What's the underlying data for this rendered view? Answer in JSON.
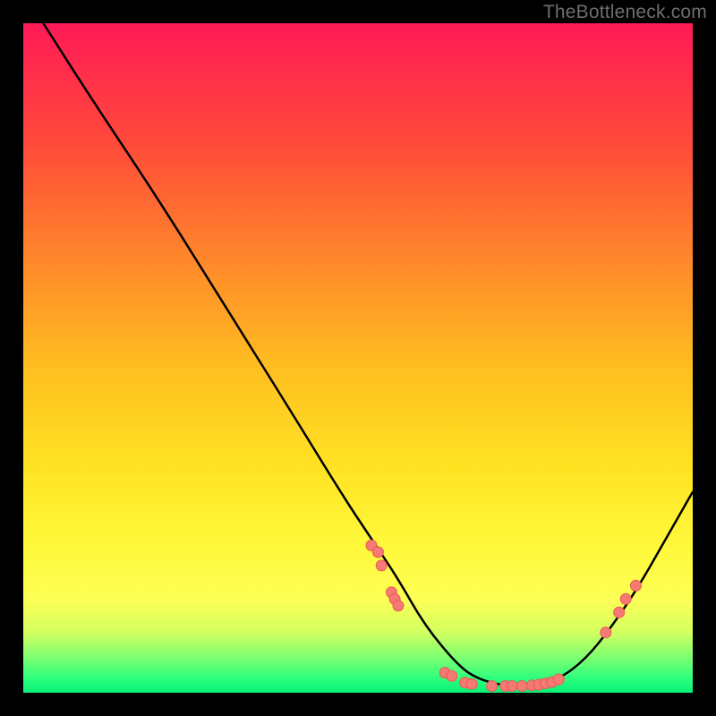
{
  "watermark": "TheBottleneck.com",
  "colors": {
    "curve": "#000000",
    "dot_fill": "#f47a73",
    "dot_stroke": "#e85a52",
    "background_black": "#000000"
  },
  "chart_data": {
    "type": "line",
    "title": "",
    "xlabel": "",
    "ylabel": "",
    "xlim": [
      0,
      100
    ],
    "ylim": [
      0,
      100
    ],
    "grid": false,
    "series": [
      {
        "name": "bottleneck-curve",
        "x": [
          3,
          10,
          20,
          30,
          40,
          48,
          52,
          56,
          60,
          65,
          68,
          72,
          76,
          80,
          84,
          88,
          92,
          96,
          100
        ],
        "y": [
          100,
          89,
          74,
          58,
          42,
          29,
          23,
          17,
          10,
          4,
          2,
          1,
          1,
          2,
          5,
          10,
          16,
          23,
          30
        ]
      }
    ],
    "points": [
      {
        "x": 52,
        "y": 22
      },
      {
        "x": 53,
        "y": 21
      },
      {
        "x": 53.5,
        "y": 19
      },
      {
        "x": 55,
        "y": 15
      },
      {
        "x": 55.5,
        "y": 14
      },
      {
        "x": 56,
        "y": 13
      },
      {
        "x": 63,
        "y": 3
      },
      {
        "x": 64,
        "y": 2.5
      },
      {
        "x": 66,
        "y": 1.5
      },
      {
        "x": 67,
        "y": 1.3
      },
      {
        "x": 70,
        "y": 1
      },
      {
        "x": 72,
        "y": 1
      },
      {
        "x": 73,
        "y": 1
      },
      {
        "x": 74.5,
        "y": 1
      },
      {
        "x": 76,
        "y": 1.1
      },
      {
        "x": 77,
        "y": 1.2
      },
      {
        "x": 78,
        "y": 1.4
      },
      {
        "x": 79,
        "y": 1.6
      },
      {
        "x": 80,
        "y": 2
      },
      {
        "x": 87,
        "y": 9
      },
      {
        "x": 89,
        "y": 12
      },
      {
        "x": 90,
        "y": 14
      },
      {
        "x": 91.5,
        "y": 16
      }
    ]
  }
}
